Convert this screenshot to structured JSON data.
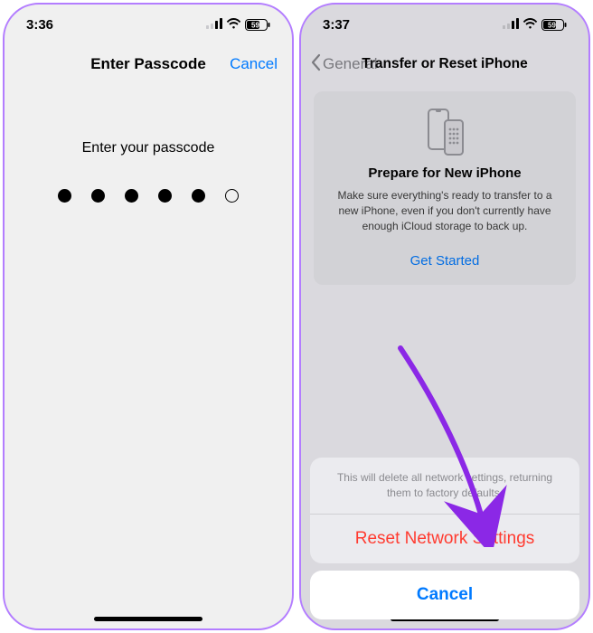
{
  "left": {
    "status": {
      "time": "3:36",
      "battery": "59"
    },
    "nav": {
      "title": "Enter Passcode",
      "cancel": "Cancel"
    },
    "prompt": "Enter your passcode",
    "dots_filled": [
      true,
      true,
      true,
      true,
      true,
      false
    ]
  },
  "right": {
    "status": {
      "time": "3:37",
      "battery": "59"
    },
    "nav": {
      "back": "General",
      "title": "Transfer or Reset iPhone"
    },
    "card": {
      "title": "Prepare for New iPhone",
      "body": "Make sure everything's ready to transfer to a new iPhone, even if you don't currently have enough iCloud storage to back up.",
      "cta": "Get Started"
    },
    "sheet": {
      "message": "This will delete all network settings, returning them to factory defaults.",
      "action": "Reset Network Settings",
      "cancel": "Cancel"
    }
  }
}
